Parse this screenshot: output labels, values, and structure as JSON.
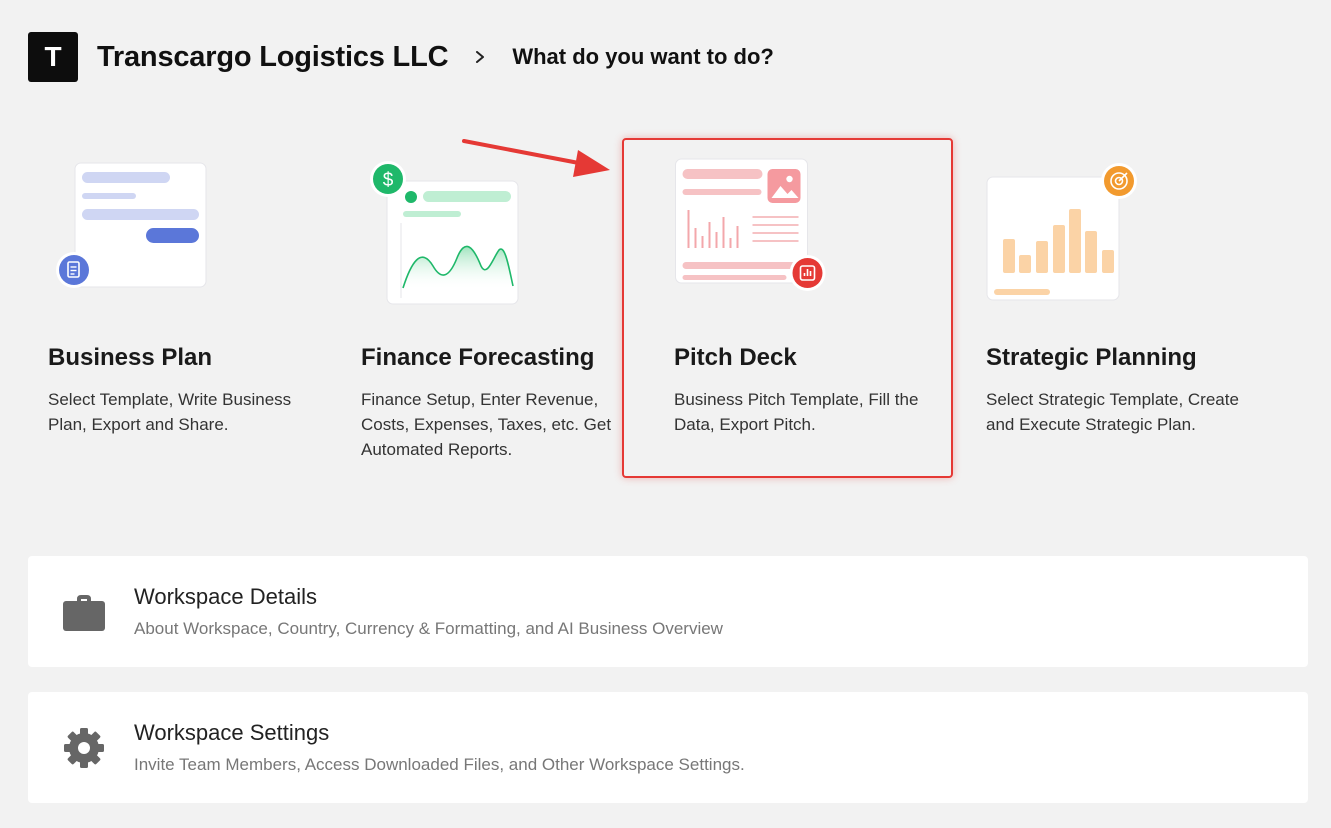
{
  "header": {
    "logo_letter": "T",
    "org_name": "Transcargo Logistics LLC",
    "breadcrumb": "What do you want to do?"
  },
  "options": [
    {
      "title": "Business Plan",
      "description": "Select Template, Write Business Plan, Export and Share.",
      "icon": "document-icon",
      "accent": "#5b77d9"
    },
    {
      "title": "Finance Forecasting",
      "description": "Finance Setup, Enter Revenue, Costs, Expenses, Taxes, etc. Get Automated Reports.",
      "icon": "dollar-icon",
      "accent": "#1fb86a"
    },
    {
      "title": "Pitch Deck",
      "description": "Business Pitch Template, Fill the Data, Export Pitch.",
      "icon": "chart-icon",
      "accent": "#e53935"
    },
    {
      "title": "Strategic Planning",
      "description": "Select Strategic Template, Create and Execute Strategic Plan.",
      "icon": "target-icon",
      "accent": "#f29a2e"
    }
  ],
  "rows": [
    {
      "title": "Workspace Details",
      "subtitle": "About Workspace, Country, Currency & Formatting, and AI Business Overview",
      "icon": "briefcase-icon"
    },
    {
      "title": "Workspace Settings",
      "subtitle": "Invite Team Members, Access Downloaded Files, and Other Workspace Settings.",
      "icon": "gear-icon"
    }
  ],
  "highlight_color": "#e53935"
}
